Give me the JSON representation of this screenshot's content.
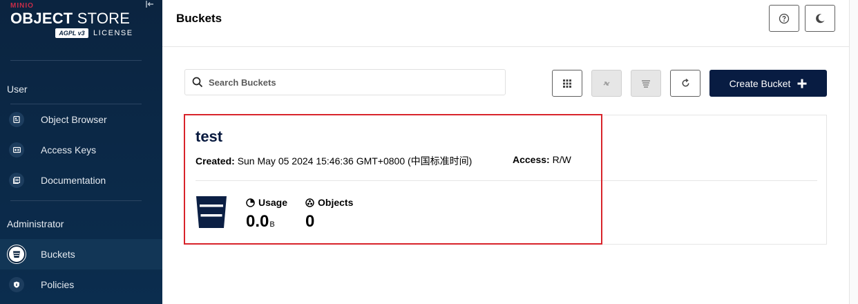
{
  "brand": {
    "maker": "MINIO",
    "product_bold": "OBJECT",
    "product_light": "STORE",
    "license_badge": "AGPL v3",
    "license_label": "LICENSE"
  },
  "sidebar": {
    "collapse_icon": "collapse-left-icon",
    "sections": [
      {
        "label": "User",
        "items": [
          {
            "label": "Object Browser",
            "icon": "object-browser-icon"
          },
          {
            "label": "Access Keys",
            "icon": "access-keys-icon"
          },
          {
            "label": "Documentation",
            "icon": "documentation-icon"
          }
        ]
      },
      {
        "label": "Administrator",
        "items": [
          {
            "label": "Buckets",
            "icon": "bucket-icon",
            "active": true
          },
          {
            "label": "Policies",
            "icon": "policy-shield-icon"
          }
        ]
      }
    ]
  },
  "header": {
    "title": "Buckets",
    "help_icon": "help-icon",
    "theme_icon": "dark-mode-moon-icon"
  },
  "toolbar": {
    "search_placeholder": "Search Buckets",
    "view_toggle_icon": "grid-view-icon",
    "replication_icon": "replication-icon",
    "lifecycle_icon": "lifecycle-icon",
    "refresh_icon": "refresh-icon",
    "create_label": "Create Bucket",
    "create_icon": "plus-icon"
  },
  "bucket": {
    "name": "test",
    "created_label": "Created:",
    "created_value": "Sun May 05 2024 15:46:36 GMT+0800 (中国标准时间)",
    "access_label": "Access:",
    "access_value": "R/W",
    "usage_label": "Usage",
    "usage_value": "0.0",
    "usage_unit": "B",
    "objects_label": "Objects",
    "objects_value": "0"
  },
  "colors": {
    "sidebar_bg": "#0b2440",
    "accent_dark": "#081c42",
    "brand_red": "#c72c48",
    "highlight_border": "#d8232a"
  }
}
